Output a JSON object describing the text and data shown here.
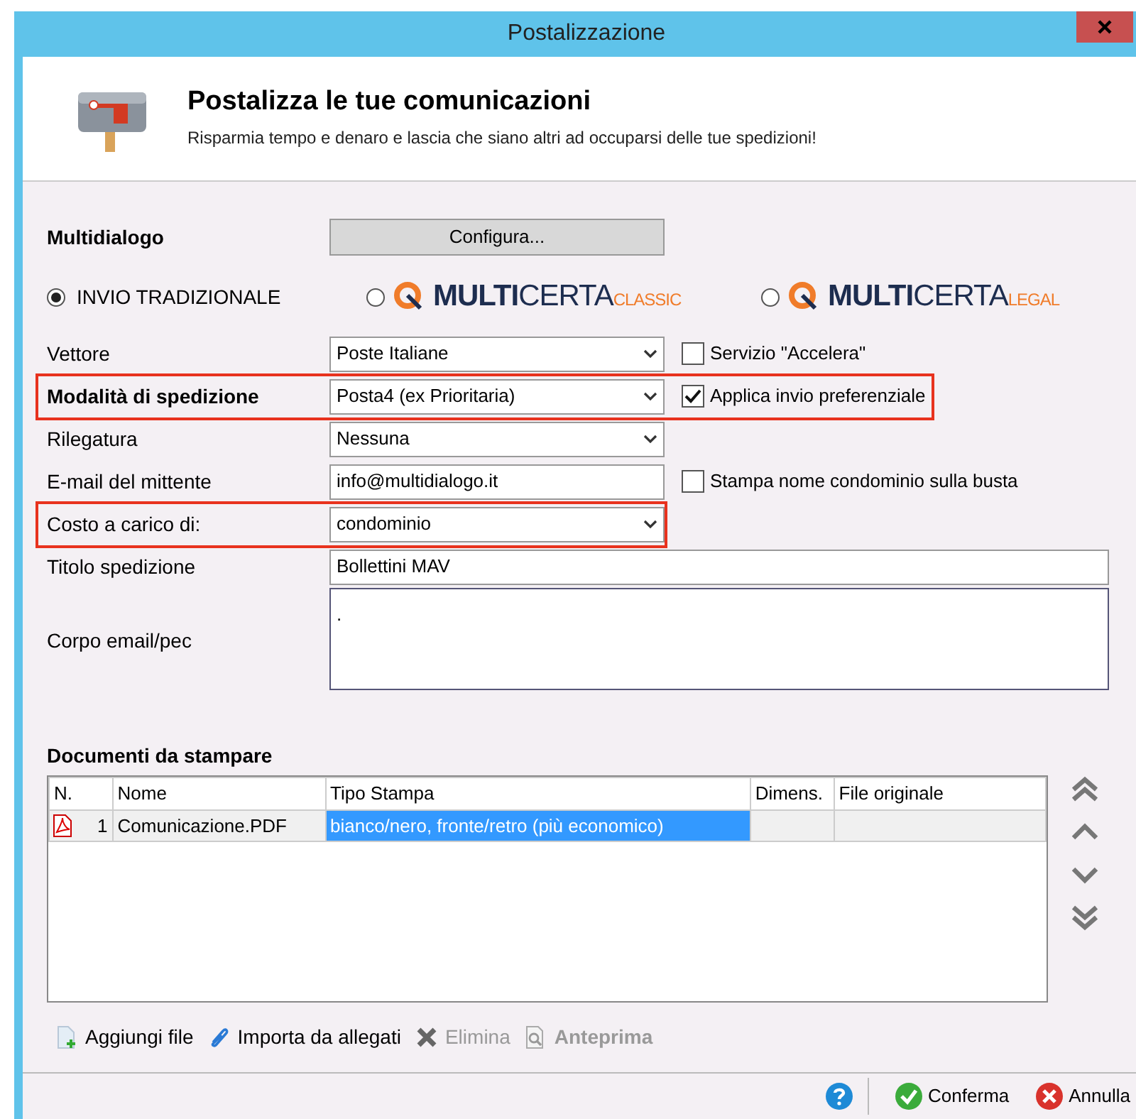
{
  "window": {
    "title": "Postalizzazione"
  },
  "header": {
    "title": "Postalizza le tue comunicazioni",
    "subtitle": "Risparmia tempo e denaro e lascia che siano altri ad occuparsi delle tue spedizioni!"
  },
  "multidialogo": {
    "label": "Multidialogo",
    "button": "Configura..."
  },
  "send_modes": [
    {
      "kind": "text",
      "label": "INVIO TRADIZIONALE",
      "selected": true
    },
    {
      "kind": "logo",
      "strong": "MULTI",
      "light": "CERTA",
      "suffix": "CLASSIC",
      "selected": false
    },
    {
      "kind": "logo",
      "strong": "MULTI",
      "light": "CERTA",
      "suffix": "LEGAL",
      "selected": false
    }
  ],
  "fields": [
    {
      "kind": "select",
      "label": "Vettore",
      "value": "Poste Italiane",
      "bold": false,
      "highlighted": false,
      "checkbox": {
        "label": "Servizio \"Accelera\"",
        "checked": false
      }
    },
    {
      "kind": "select",
      "label": "Modalità di spedizione",
      "value": "Posta4 (ex Prioritaria)",
      "bold": true,
      "highlighted": true,
      "checkbox": {
        "label": "Applica invio preferenziale",
        "checked": true
      }
    },
    {
      "kind": "select",
      "label": "Rilegatura",
      "value": "Nessuna",
      "bold": false,
      "highlighted": false
    },
    {
      "kind": "input",
      "label": "E-mail del mittente",
      "value": "info@multidialogo.it",
      "bold": false,
      "highlighted": false,
      "checkbox": {
        "label": "Stampa nome condominio sulla busta",
        "checked": false
      }
    },
    {
      "kind": "select",
      "label": "Costo a carico di:",
      "value": "condominio",
      "bold": false,
      "highlighted": true
    },
    {
      "kind": "wide",
      "label": "Titolo spedizione",
      "value": "Bollettini MAV",
      "bold": false,
      "highlighted": false
    },
    {
      "kind": "textarea",
      "label": "Corpo email/pec",
      "value": ".",
      "bold": false,
      "highlighted": false
    }
  ],
  "documents": {
    "title": "Documenti da stampare",
    "columns": [
      "N.",
      "Nome",
      "Tipo Stampa",
      "Dimens.",
      "File originale"
    ],
    "rows": [
      {
        "cells": [
          {
            "text": "1",
            "selected": false
          },
          {
            "text": "Comunicazione.PDF",
            "selected": false
          },
          {
            "text": "bianco/nero, fronte/retro (più economico)",
            "selected": true
          },
          {
            "text": "",
            "selected": false
          },
          {
            "text": "",
            "selected": false
          }
        ]
      }
    ]
  },
  "toolbar": [
    {
      "kind": "add",
      "label": "Aggiungi file",
      "disabled": false,
      "bold": false
    },
    {
      "kind": "attach",
      "label": "Importa da allegati",
      "disabled": false,
      "bold": false
    },
    {
      "kind": "delete",
      "label": "Elimina",
      "disabled": true,
      "bold": false
    },
    {
      "kind": "preview",
      "label": "Anteprima",
      "disabled": true,
      "bold": true
    }
  ],
  "footer": {
    "buttons": [
      {
        "kind": "confirm",
        "label": "Conferma"
      },
      {
        "kind": "cancel",
        "label": "Annulla"
      }
    ]
  }
}
